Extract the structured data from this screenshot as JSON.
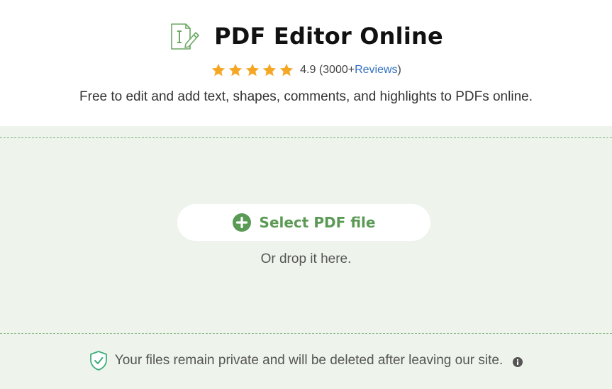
{
  "header": {
    "title": "PDF Editor Online",
    "app_icon": "pdf-edit-icon",
    "rating": {
      "stars": 5,
      "score": "4.9",
      "count_prefix": "(3000+ ",
      "reviews_label": "Reviews",
      "count_suffix": ")"
    },
    "subtitle": "Free to edit and add text, shapes, comments, and highlights to PDFs online."
  },
  "dropzone": {
    "button_icon": "plus-circle-icon",
    "button_label": "Select PDF file",
    "hint": "Or drop it here."
  },
  "privacy": {
    "icon": "shield-check-icon",
    "text": "Your files remain private and will be deleted after leaving our site.",
    "info_icon": "info-icon"
  },
  "colors": {
    "accent_green": "#5b9a55",
    "dropzone_bg": "#eef4ec",
    "star": "#f5a623",
    "link": "#2f6fc0"
  }
}
